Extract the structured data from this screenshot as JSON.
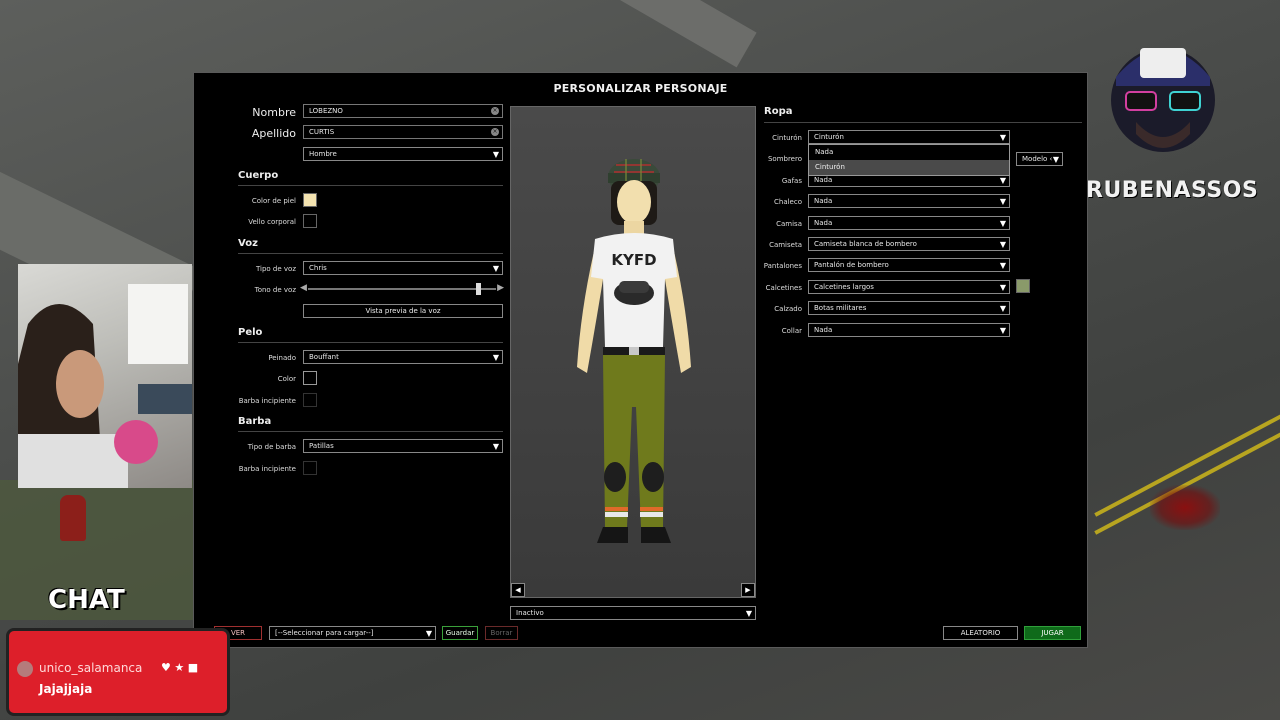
{
  "panel": {
    "title": "PERSONALIZAR PERSONAJE"
  },
  "identity": {
    "nombre_label": "Nombre",
    "nombre_value": "LOBEZNO",
    "apellido_label": "Apellido",
    "apellido_value": "CURTIS",
    "gender_value": "Hombre"
  },
  "cuerpo": {
    "section": "Cuerpo",
    "skin_label": "Color de piel",
    "skin_color": "#f3e2b0",
    "hair_label": "Vello corporal"
  },
  "voz": {
    "section": "Voz",
    "type_label": "Tipo de voz",
    "type_value": "Chris",
    "tone_label": "Tono de voz",
    "tone_level": 0.92,
    "preview_button": "Vista previa de la voz"
  },
  "pelo": {
    "section": "Pelo",
    "style_label": "Peinado",
    "style_value": "Bouffant",
    "color_label": "Color",
    "stubble_label": "Barba incipiente"
  },
  "barba": {
    "section": "Barba",
    "type_label": "Tipo de barba",
    "type_value": "Patillas",
    "stubble_label": "Barba incipiente"
  },
  "preview": {
    "animation_value": "Inactivo",
    "prev": "◀",
    "next": "▶"
  },
  "ropa": {
    "section": "Ropa",
    "rows": [
      {
        "label": "Cinturón",
        "value": "Cinturón"
      },
      {
        "label": "Sombrero",
        "value": ""
      },
      {
        "label": "Gafas",
        "value": "Nada"
      },
      {
        "label": "Chaleco",
        "value": "Nada"
      },
      {
        "label": "Camisa",
        "value": "Nada"
      },
      {
        "label": "Camiseta",
        "value": "Camiseta blanca de bombero"
      },
      {
        "label": "Pantalones",
        "value": "Pantalón de bombero"
      },
      {
        "label": "Calcetines",
        "value": "Calcetines largos"
      },
      {
        "label": "Calzado",
        "value": "Botas militares"
      },
      {
        "label": "Collar",
        "value": "Nada"
      }
    ],
    "open_list": [
      "Nada",
      "Cinturón"
    ],
    "model_value": "Modelo ‹",
    "sock_color": "#8a9a6a"
  },
  "bottom": {
    "back": "VER",
    "load_select": "[--Seleccionar para cargar--]",
    "save": "Guardar",
    "delete": "Borrar",
    "random": "ALEATORIO",
    "play": "JUGAR"
  },
  "overlay": {
    "brand": "RUBENASSOS",
    "chat_title": "CHAT",
    "chat_user": "unico_salamanca",
    "chat_message": "Jajajjaja"
  }
}
